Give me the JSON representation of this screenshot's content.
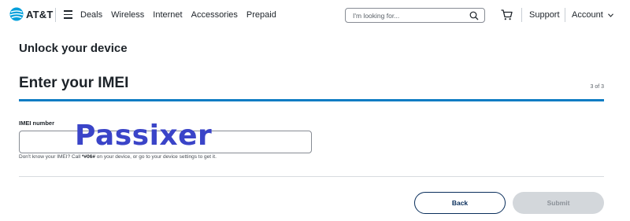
{
  "header": {
    "brand": "AT&T",
    "nav": [
      "Deals",
      "Wireless",
      "Internet",
      "Accessories",
      "Prepaid"
    ],
    "search_placeholder": "I'm looking for...",
    "support_label": "Support",
    "account_label": "Account"
  },
  "main": {
    "page_title": "Unlock your device",
    "step_title": "Enter your IMEI",
    "step_counter": "3 of 3",
    "field_label": "IMEI number",
    "field_value": "",
    "helper_prefix": "Don't know your IMEI? Call ",
    "helper_code": "*#06#",
    "helper_suffix": " on your device, or go to your device settings to get it.",
    "watermark": "Passixer",
    "back_label": "Back",
    "submit_label": "Submit"
  },
  "colors": {
    "accent": "#0e7cc3",
    "brand_blue": "#009fdb",
    "button_navy": "#0a2f5c",
    "disabled_grey": "#d3d7db",
    "watermark": "#3a44c8"
  },
  "icons": [
    "att-globe-icon",
    "menu-icon",
    "search-icon",
    "cart-icon",
    "chevron-down-icon"
  ]
}
